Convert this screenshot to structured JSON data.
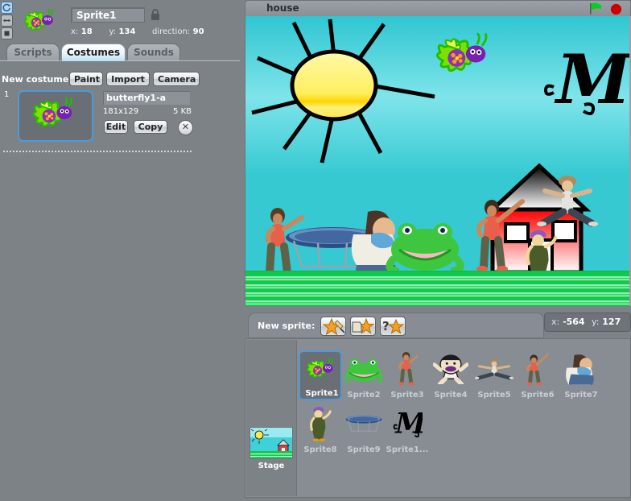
{
  "left_panel": {
    "rotation_buttons": [
      {
        "name": "rotate-freely",
        "selected": true
      },
      {
        "name": "left-right-flip",
        "selected": false
      },
      {
        "name": "no-rotate",
        "selected": false
      }
    ],
    "sprite_name": "Sprite1",
    "lock_icon": "lock-icon",
    "coords": {
      "x_label": "x:",
      "x_value": "18",
      "y_label": "y:",
      "y_value": "134",
      "dir_label": "direction:",
      "dir_value": "90"
    },
    "tabs": [
      {
        "label": "Scripts",
        "active": false
      },
      {
        "label": "Costumes",
        "active": true
      },
      {
        "label": "Sounds",
        "active": false
      }
    ],
    "new_costume": {
      "label": "New costume:",
      "paint": "Paint",
      "import": "Import",
      "camera": "Camera"
    },
    "costumes": [
      {
        "index": "1",
        "name": "butterfly1-a",
        "dimensions": "181x129",
        "filesize": "5 KB",
        "edit": "Edit",
        "copy": "Copy",
        "delete": "✕"
      }
    ]
  },
  "stage": {
    "project_title": "house",
    "green_flag_icon": "green-flag-icon",
    "stop_icon": "stop-sign-icon",
    "colors": {
      "sky_top": "#2fc6d2",
      "sky_light": "#7fe4ea",
      "grass": "#12c94e",
      "house_body": "#ff0000",
      "sun": "#ffe800"
    }
  },
  "sprite_bar": {
    "new_sprite_label": "New sprite:",
    "buttons": [
      {
        "name": "paint-new-sprite-button",
        "icon": "star-brush-icon"
      },
      {
        "name": "import-sprite-button",
        "icon": "star-folder-icon"
      },
      {
        "name": "surprise-sprite-button",
        "icon": "star-question-icon"
      }
    ],
    "mouse_readout": {
      "x_label": "x:",
      "x_value": "-564",
      "y_label": "y:",
      "y_value": "127"
    }
  },
  "sprite_pane": {
    "stage_item": {
      "label": "Stage",
      "name": "stage-thumbnail"
    },
    "sprites": [
      {
        "label": "Sprite1",
        "art": "butterfly",
        "selected": true
      },
      {
        "label": "Sprite2",
        "art": "frog",
        "selected": false
      },
      {
        "label": "Sprite3",
        "art": "dancer-red",
        "selected": false
      },
      {
        "label": "Sprite4",
        "art": "baby",
        "selected": false
      },
      {
        "label": "Sprite5",
        "art": "splits",
        "selected": false
      },
      {
        "label": "Sprite6",
        "art": "dancer-arm-up",
        "selected": false
      },
      {
        "label": "Sprite7",
        "art": "crouching",
        "selected": false
      },
      {
        "label": "Sprite8",
        "art": "grandma",
        "selected": false
      },
      {
        "label": "Sprite9",
        "art": "trampoline",
        "selected": false
      },
      {
        "label": "Sprite1...",
        "art": "letter-m",
        "selected": false
      }
    ]
  }
}
